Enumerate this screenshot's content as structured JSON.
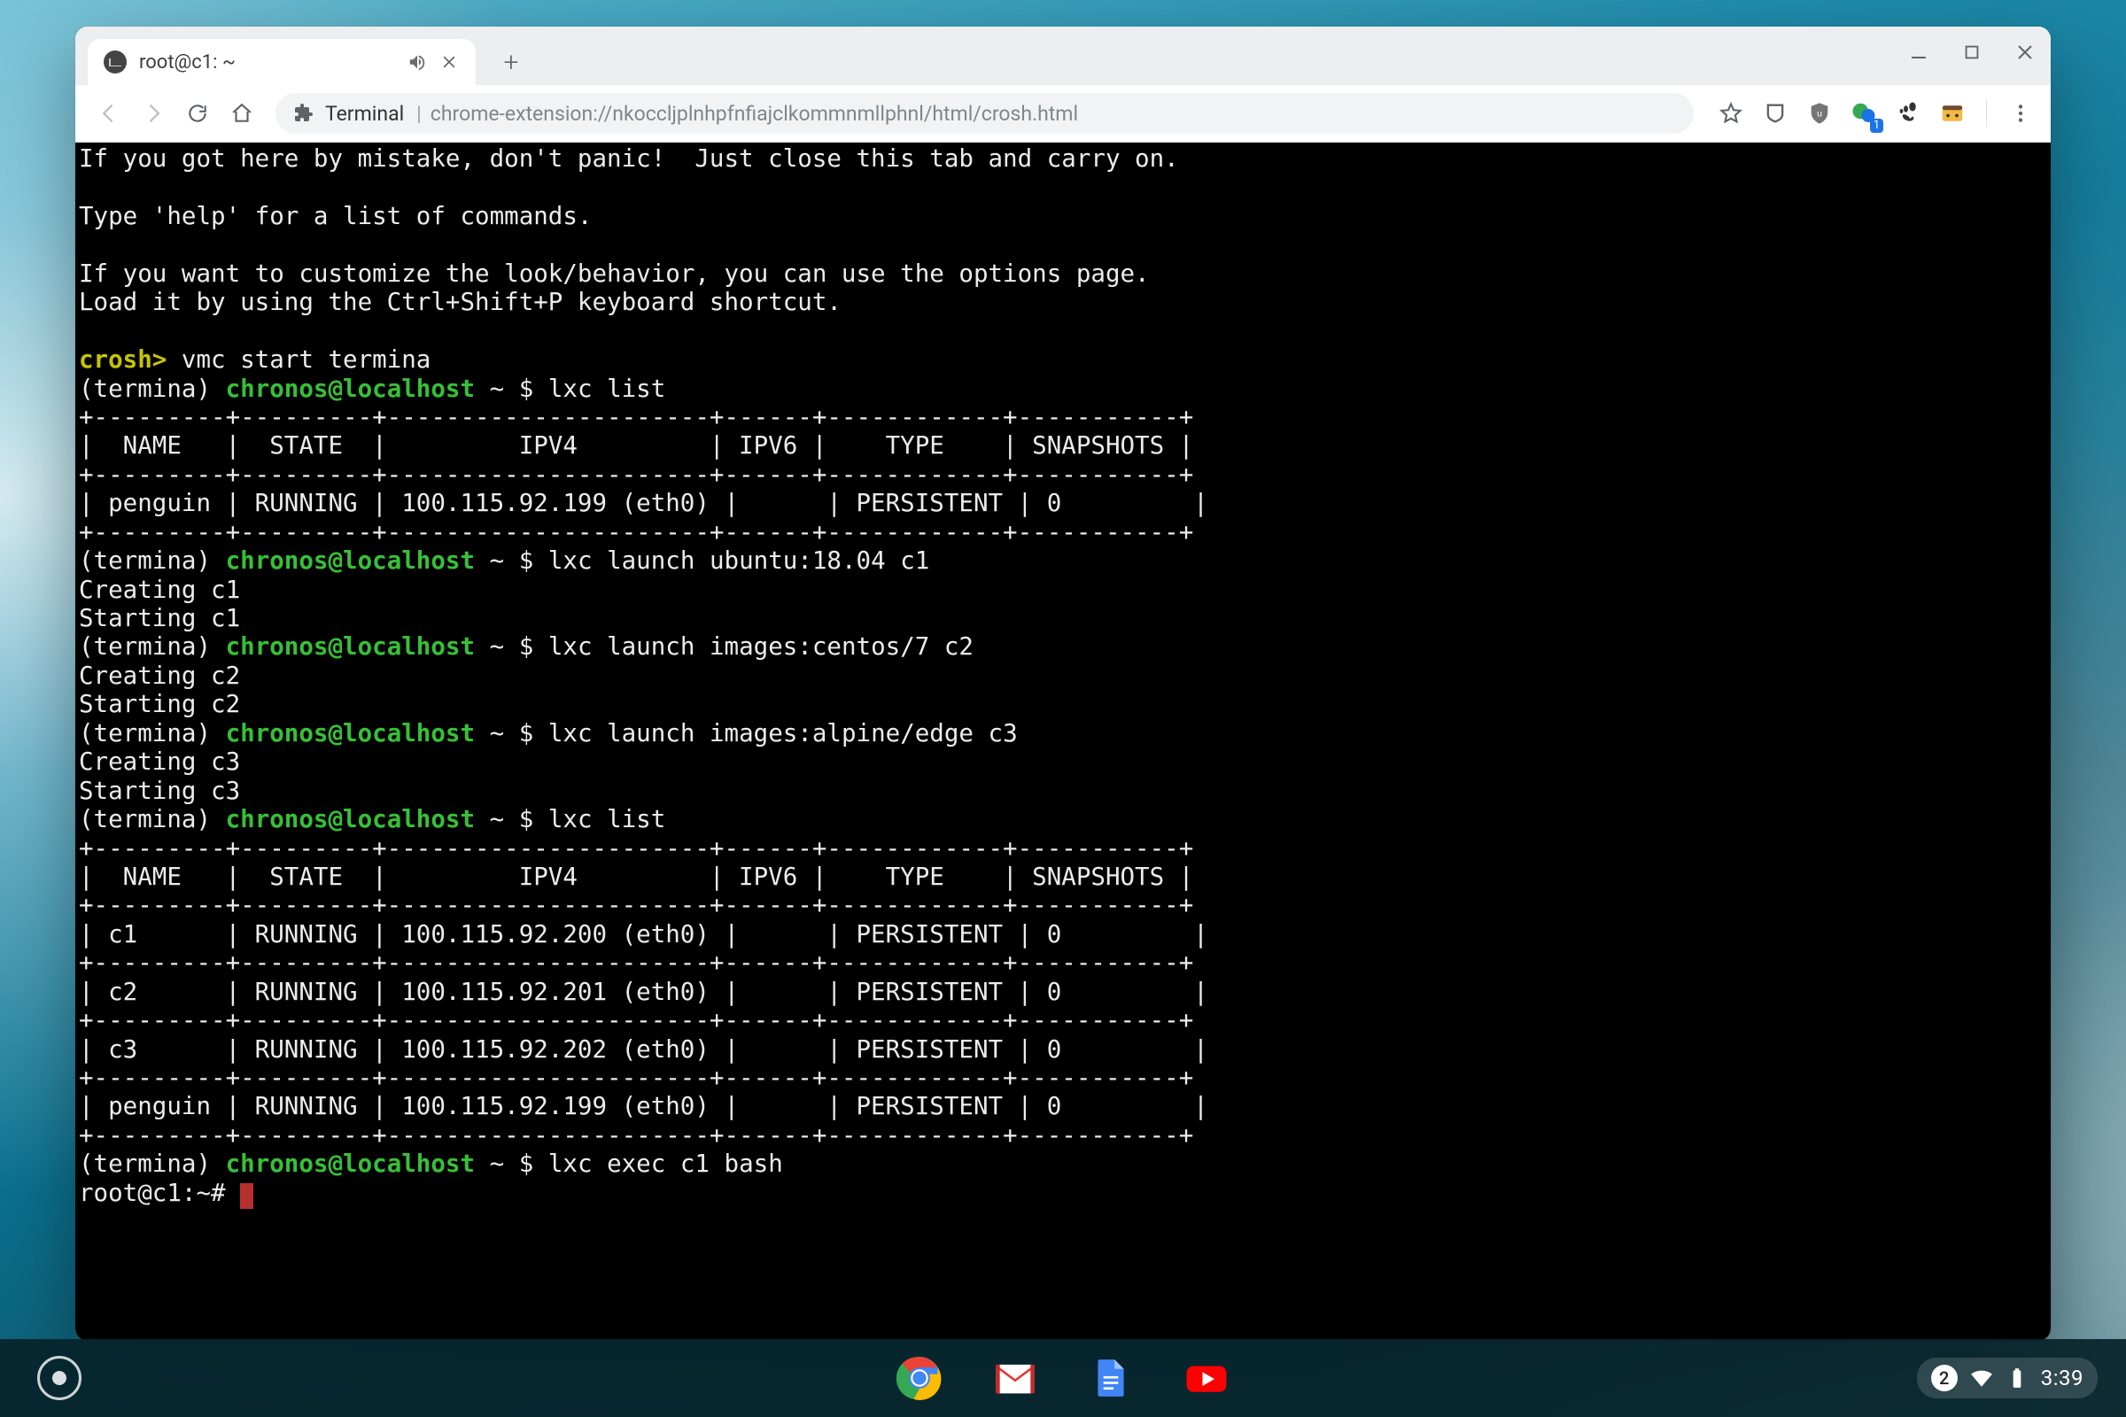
{
  "tab": {
    "title": "root@c1: ~"
  },
  "omnibox": {
    "label": "Terminal",
    "url": "chrome-extension://nkoccljplnhpfnfiajclkommnmllphnl/html/crosh.html"
  },
  "ext_badge": "1",
  "tray": {
    "count": "2",
    "clock": "3:39"
  },
  "term": {
    "l0": "If you got here by mistake, don't panic!  Just close this tab and carry on.",
    "l1": "",
    "l2": "Type 'help' for a list of commands.",
    "l3": "",
    "l4": "If you want to customize the look/behavior, you can use the options page.",
    "l5": "Load it by using the Ctrl+Shift+P keyboard shortcut.",
    "l6": "",
    "crosh": "crosh>",
    "croshcmd": " vmc start termina",
    "p_open": "(termina) ",
    "p_user": "chronos@localhost",
    "p_tail": " ~ $ ",
    "cmd1": "lxc list",
    "hr": "+---------+---------+----------------------+------+------------+-----------+",
    "hdr": "|  NAME   |  STATE  |         IPV4         | IPV6 |    TYPE    | SNAPSHOTS |",
    "row_penguin": "| penguin | RUNNING | 100.115.92.199 (eth0) |      | PERSISTENT | 0         |",
    "cmd2": "lxc launch ubuntu:18.04 c1",
    "cre1": "Creating c1",
    "sta1": "Starting c1",
    "cmd3": "lxc launch images:centos/7 c2",
    "cre2": "Creating c2",
    "sta2": "Starting c2",
    "cmd4": "lxc launch images:alpine/edge c3",
    "cre3": "Creating c3",
    "sta3": "Starting c3",
    "cmd5": "lxc list",
    "row_c1": "| c1      | RUNNING | 100.115.92.200 (eth0) |      | PERSISTENT | 0         |",
    "row_c2": "| c2      | RUNNING | 100.115.92.201 (eth0) |      | PERSISTENT | 0         |",
    "row_c3": "| c3      | RUNNING | 100.115.92.202 (eth0) |      | PERSISTENT | 0         |",
    "cmd6": "lxc exec c1 bash",
    "rootprompt": "root@c1:~# "
  }
}
